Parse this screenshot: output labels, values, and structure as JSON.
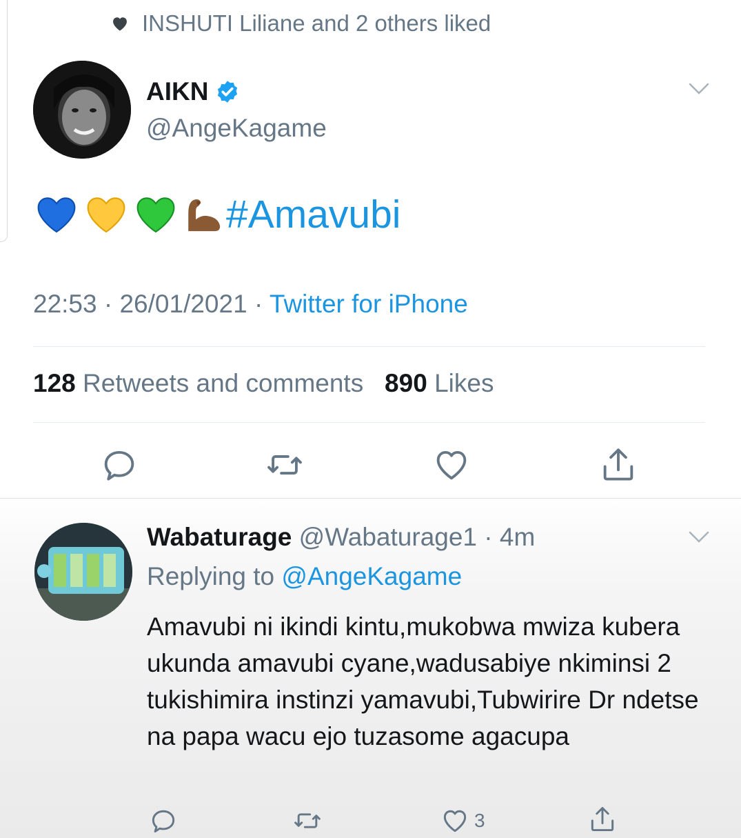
{
  "liked_header": {
    "text": "INSHUTI Liliane and 2 others liked"
  },
  "main_tweet": {
    "display_name": "AIKN",
    "handle": "@AngeKagame",
    "hashtag": "#Amavubi",
    "emojis": [
      "blue-heart",
      "yellow-heart",
      "green-heart",
      "flexed-biceps"
    ],
    "time": "22:53",
    "date": "26/01/2021",
    "source": "Twitter for iPhone",
    "retweets_count": "128",
    "retweets_label": "Retweets and comments",
    "likes_count": "890",
    "likes_label": "Likes"
  },
  "reply": {
    "display_name": "Wabaturage",
    "handle": "@Wabaturage1",
    "age": "4m",
    "replying_label": "Replying to",
    "replying_handle": "@AngeKagame",
    "text": "Amavubi ni ikindi kintu,mukobwa mwiza kubera ukunda amavubi cyane,wadusabiye nkiminsi 2 tukishimira instinzi yamavubi,Tubwirire Dr ndetse na papa wacu ejo tuzasome agacupa",
    "like_count": "3"
  },
  "colors": {
    "link_blue": "#1b95e0",
    "secondary_gray": "#657786",
    "verified_blue": "#1da1f2"
  }
}
